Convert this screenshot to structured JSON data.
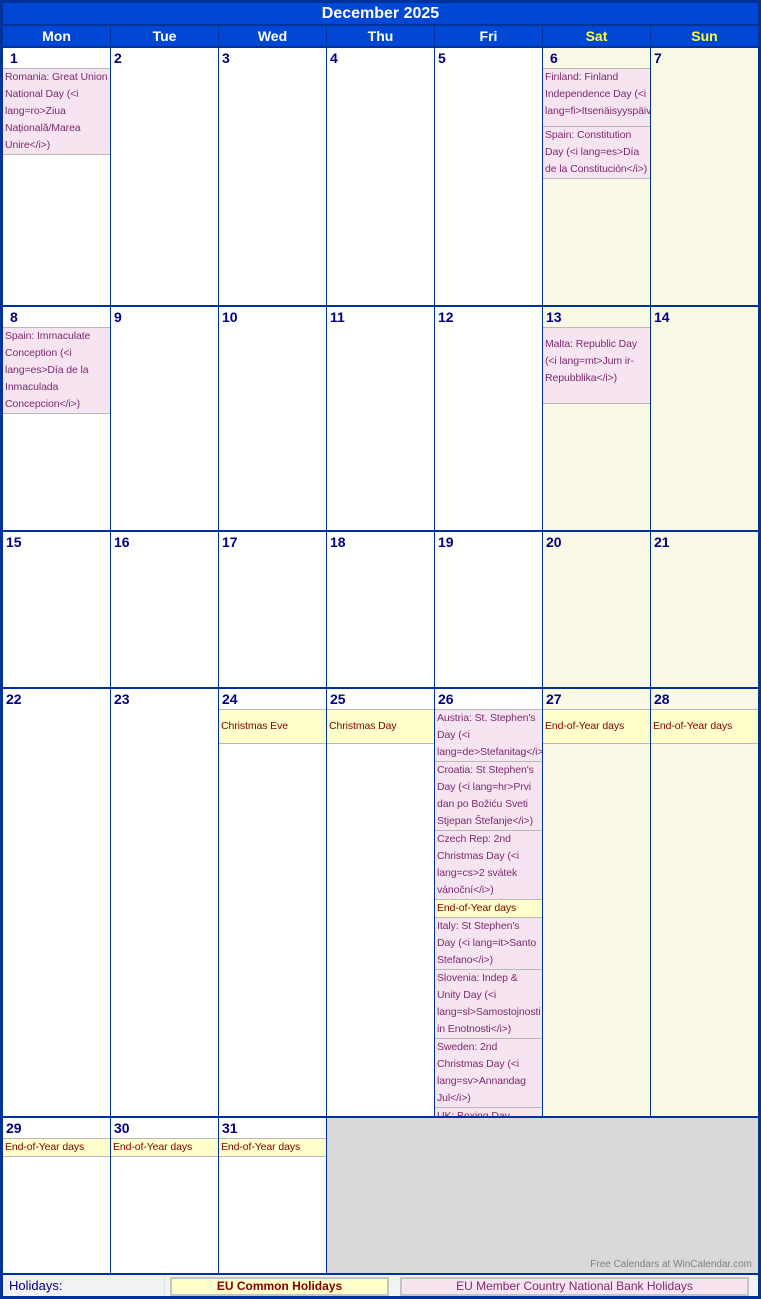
{
  "title": "December 2025",
  "weekdays": [
    {
      "label": "Mon",
      "weekend": false
    },
    {
      "label": "Tue",
      "weekend": false
    },
    {
      "label": "Wed",
      "weekend": false
    },
    {
      "label": "Thu",
      "weekend": false
    },
    {
      "label": "Fri",
      "weekend": false
    },
    {
      "label": "Sat",
      "weekend": true
    },
    {
      "label": "Sun",
      "weekend": true
    }
  ],
  "colors": {
    "header_bg": "#0047D6",
    "border": "#003399",
    "weekend_header_text": "#FFFF33",
    "weekend_bg": "#FAF9E5",
    "eu_holiday_bg": "#FFFFCC",
    "eu_holiday_text": "#800000",
    "national_holiday_bg": "#F7E4F1",
    "national_holiday_text": "#7C2A6E",
    "day_number": "#000080"
  },
  "days": {
    "1": [
      {
        "type": "nat",
        "text": "Romania: Great Union National Day (<i lang=ro>Ziua Națională/Marea Unire</i>)"
      }
    ],
    "6": [
      {
        "type": "nat",
        "text": "Finland: Finland Independence Day (<i lang=fi>Itsenäisyyspäivä</i>)"
      },
      {
        "type": "nat",
        "text": "Spain: Constitution Day (<i lang=es>Día de la Constitución</i>)"
      }
    ],
    "8": [
      {
        "type": "nat",
        "text": "Spain: Immaculate Conception (<i lang=es>Día de la Inmaculada Concepcion</i>)"
      }
    ],
    "13": [
      {
        "type": "nat",
        "text": "Malta: Republic Day (<i lang=mt>Jum ir-Repubblika</i>)"
      }
    ],
    "24": [
      {
        "type": "eu",
        "text": "Christmas Eve"
      }
    ],
    "25": [
      {
        "type": "eu",
        "text": "Christmas Day"
      }
    ],
    "26": [
      {
        "type": "nat",
        "text": "Austria: St. Stephen's Day (<i lang=de>Stefanitag</i>"
      },
      {
        "type": "nat",
        "text": "Croatia: St Stephen's Day (<i lang=hr>Prvi dan po Božiću Sveti Stjepan Štefanje</i>)"
      },
      {
        "type": "nat",
        "text": "Czech Rep: 2nd Christmas Day (<i lang=cs>2 svátek vánoční</i>)"
      },
      {
        "type": "eu",
        "text": "End-of-Year days"
      },
      {
        "type": "nat",
        "text": "Italy: St Stephen's Day (<i lang=it>Santo Stefano</i>)"
      },
      {
        "type": "nat",
        "text": "Slovenia: Indep & Unity Day (<i lang=sl>Samostojnosti in Enotnosti</i>)"
      },
      {
        "type": "nat",
        "text": "Sweden: 2nd Christmas Day (<i lang=sv>Annandag Jul</i>)"
      },
      {
        "type": "nat",
        "text": "UK: Boxing Day"
      }
    ],
    "27": [
      {
        "type": "eu",
        "text": "End-of-Year days"
      }
    ],
    "28": [
      {
        "type": "eu",
        "text": "End-of-Year days"
      }
    ],
    "29": [
      {
        "type": "eu",
        "text": "End-of-Year days"
      }
    ],
    "30": [
      {
        "type": "eu",
        "text": "End-of-Year days"
      }
    ],
    "31": [
      {
        "type": "eu",
        "text": "End-of-Year days"
      }
    ]
  },
  "watermark": "Free Calendars at WinCalendar.com",
  "footer": {
    "label": "Holidays:",
    "legend_eu": "EU Common Holidays",
    "legend_national": "EU Member Country National Bank Holidays"
  }
}
